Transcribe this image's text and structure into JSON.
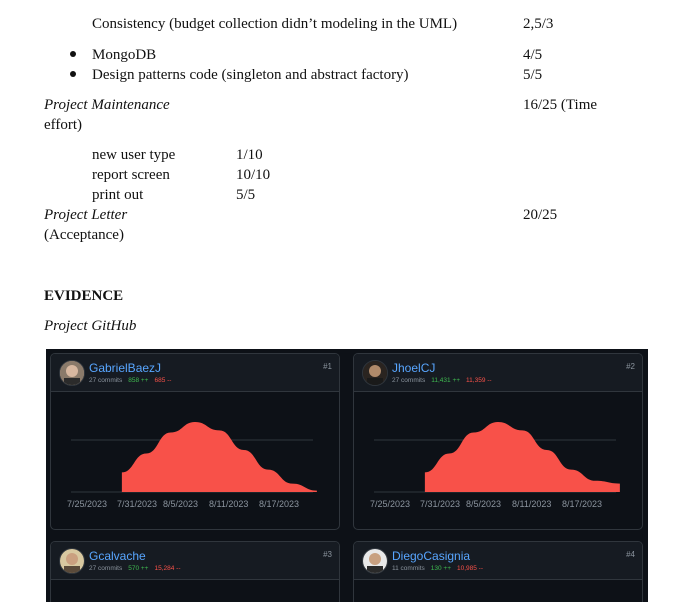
{
  "doc": {
    "line1": "Consistency (budget collection didn’t modeling in the UML)",
    "line1_score": "2,5/3",
    "bullet1": "MongoDB",
    "bullet1_score": "4/5",
    "bullet2": "Design patterns code  (singleton and abstract factory)",
    "bullet2_score": "5/5",
    "maint_title": "Project Maintenance",
    "maint_score": "16/25 (Time",
    "maint_cont": "effort)",
    "sub1": "new user type",
    "sub1_score": "1/10",
    "sub2": "report screen",
    "sub2_score": "10/10",
    "sub3": "print out",
    "sub3_score": "5/5",
    "letter_title": "Project Letter",
    "letter_score": "20/25",
    "letter_cont": "(Acceptance)",
    "evidence": "EVIDENCE",
    "github": "Project GitHub"
  },
  "contributors": [
    {
      "name": "GabrielBaezJ",
      "commits": "27 commits",
      "additions": "858 ++",
      "deletions": "685 --",
      "rank": "#1"
    },
    {
      "name": "JhoelCJ",
      "commits": "27 commits",
      "additions": "11,431 ++",
      "deletions": "11,359 --",
      "rank": "#2"
    },
    {
      "name": "Gcalvache",
      "commits": "27 commits",
      "additions": "570 ++",
      "deletions": "15,284 --",
      "rank": "#3"
    },
    {
      "name": "DiegoCasignia",
      "commits": "11 commits",
      "additions": "130 ++",
      "deletions": "10,985 --",
      "rank": "#4"
    }
  ],
  "chart_data": [
    {
      "type": "area",
      "series": [
        {
          "name": "GabrielBaezJ",
          "x": [
            "7/29/2023",
            "8/1/2023",
            "8/4/2023",
            "8/7/2023",
            "8/10/2023",
            "8/13/2023",
            "8/16/2023",
            "8/19/2023",
            "8/22/2023"
          ],
          "values": [
            0.28,
            0.55,
            0.85,
            1.0,
            0.88,
            0.6,
            0.32,
            0.12,
            0.02
          ]
        }
      ],
      "x_tick_labels": [
        "7/25/2023",
        "7/31/2023",
        "8/5/2023",
        "8/11/2023",
        "8/17/2023"
      ],
      "grid": true,
      "color": "#f85149"
    },
    {
      "type": "area",
      "series": [
        {
          "name": "JhoelCJ",
          "x": [
            "7/29/2023",
            "8/1/2023",
            "8/4/2023",
            "8/7/2023",
            "8/10/2023",
            "8/13/2023",
            "8/16/2023",
            "8/19/2023",
            "8/22/2023"
          ],
          "values": [
            0.28,
            0.55,
            0.85,
            1.0,
            0.88,
            0.6,
            0.32,
            0.16,
            0.12
          ]
        }
      ],
      "x_tick_labels": [
        "7/25/2023",
        "7/31/2023",
        "8/5/2023",
        "8/11/2023",
        "8/17/2023"
      ],
      "grid": true,
      "color": "#f85149"
    }
  ]
}
